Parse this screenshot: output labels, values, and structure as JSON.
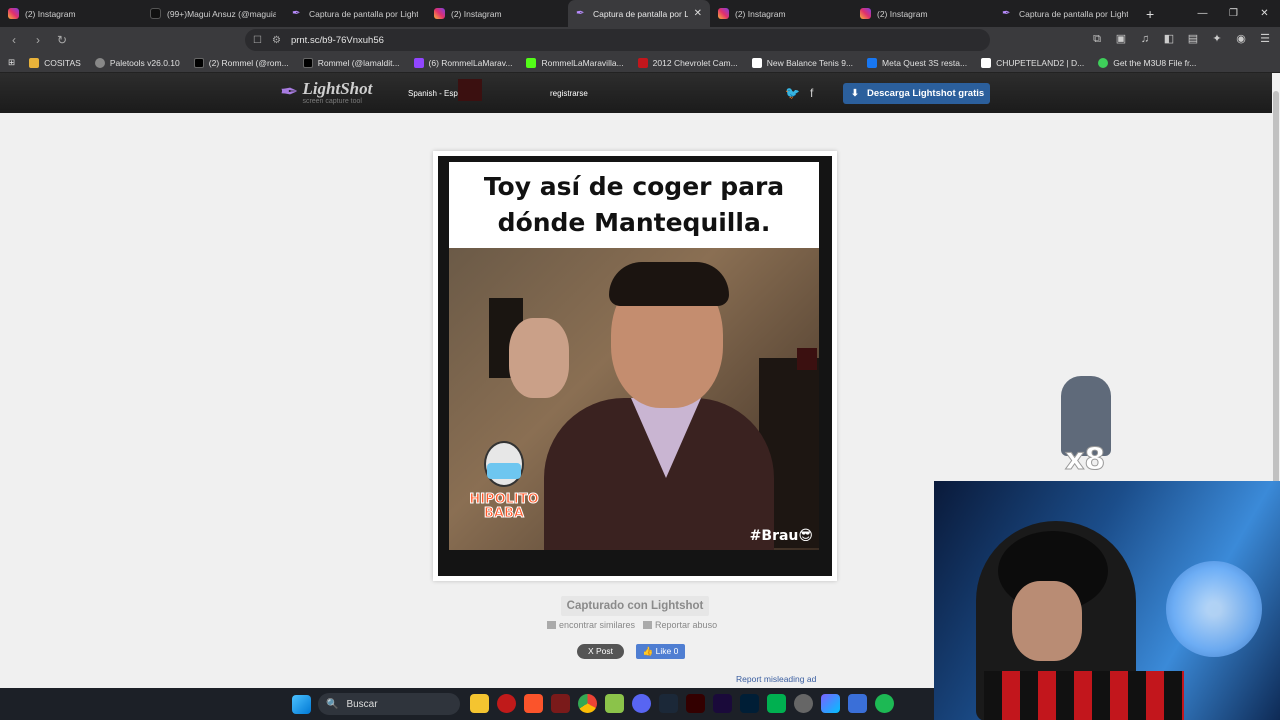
{
  "tabs": [
    {
      "label": "(2) Instagram",
      "icon": "instagram-icon",
      "active": false
    },
    {
      "label": "(99+)Magui Ansuz (@maguians",
      "icon": "tiktok-icon",
      "active": false
    },
    {
      "label": "Captura de pantalla por Lightsh",
      "icon": "lightshot-icon",
      "active": false
    },
    {
      "label": "(2) Instagram",
      "icon": "instagram-icon",
      "active": false
    },
    {
      "label": "Captura de pantalla por Li",
      "icon": "lightshot-icon",
      "active": true
    },
    {
      "label": "(2) Instagram",
      "icon": "instagram-icon",
      "active": false
    },
    {
      "label": "(2) Instagram",
      "icon": "instagram-icon",
      "active": false
    },
    {
      "label": "Captura de pantalla por Lights",
      "icon": "lightshot-icon",
      "active": false
    }
  ],
  "address": {
    "url": "prnt.sc/b9-76Vnxuh56"
  },
  "bookmarks": [
    {
      "label": "COSITAS",
      "color": "#e8b23a"
    },
    {
      "label": "Paletools v26.0.10",
      "color": "#888888"
    },
    {
      "label": "(2) Rommel (@rom...",
      "color": "#000000"
    },
    {
      "label": "Rommel (@lamaldit...",
      "color": "#000000"
    },
    {
      "label": "(6) RommelLaMarav...",
      "color": "#9146ff"
    },
    {
      "label": "RommelLaMaravilla...",
      "color": "#53fc18"
    },
    {
      "label": "2012 Chevrolet Cam...",
      "color": "#c2161c"
    },
    {
      "label": "New Balance Tenis 9...",
      "color": "#ffffff"
    },
    {
      "label": "Meta Quest 3S resta...",
      "color": "#1877f2"
    },
    {
      "label": "CHUPETELAND2 | D...",
      "color": "#ffffff"
    },
    {
      "label": "Get the M3U8 File fr...",
      "color": "#3ecf5a"
    }
  ],
  "lightshot": {
    "logo": "LightShot",
    "tagline": "screen capture tool",
    "language": "Spanish - Espa",
    "register": "registrarse",
    "download": "Descarga Lightshot gratis"
  },
  "meme": {
    "line1": "Toy así de coger para",
    "line2": "dónde Mantequilla.",
    "sticker1": "HIPOLITO",
    "sticker2": "BABA",
    "hashtag": "#Brau😎"
  },
  "footer": {
    "captured": "Capturado con Lightshot",
    "similar": "encontrar similares",
    "report_abuse": "Reportar abuso",
    "x_post": "X  Post",
    "fb_like": "👍 Like 0",
    "report_ad": "Report misleading ad"
  },
  "overlay": {
    "sticker_text": "x8"
  },
  "taskbar": {
    "search_placeholder": "Buscar"
  }
}
